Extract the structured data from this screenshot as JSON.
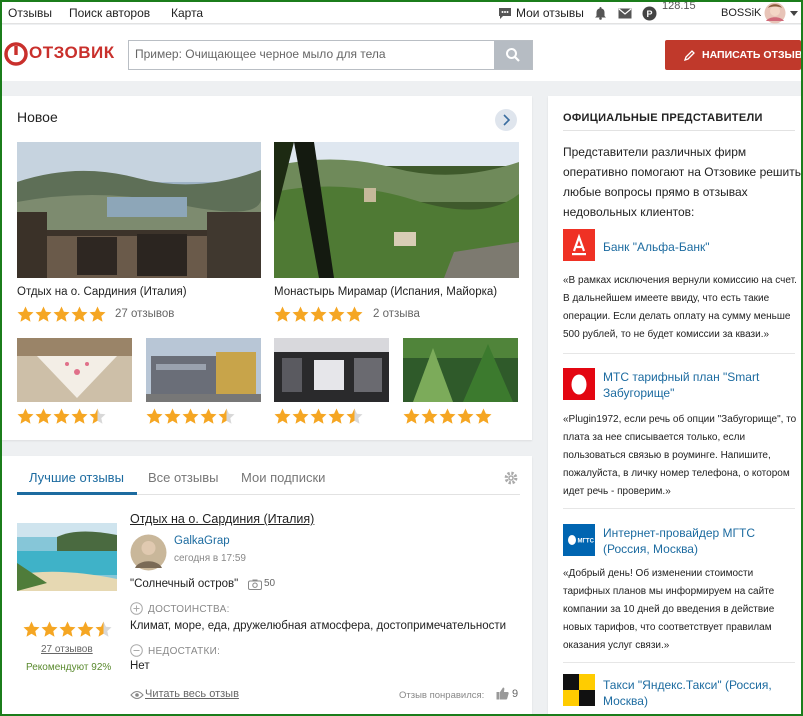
{
  "topnav": {
    "items": [
      "Отзывы",
      "Поиск авторов",
      "Карта"
    ],
    "my_reviews": "Мои отзывы",
    "rating": "128.15",
    "username": "BOSSiK"
  },
  "header": {
    "logo_text": "ОТЗОВИК",
    "search_placeholder": "Пример: Очищающее черное мыло для тела",
    "write_button": "НАПИСАТЬ ОТЗЫВ"
  },
  "new_section": {
    "title": "Новое",
    "featured": [
      {
        "title": "Отдых на о. Сардиния (Италия)",
        "rating": 5,
        "count": "27 отзывов"
      },
      {
        "title": "Монастырь Мирамар (Испания, Майорка)",
        "rating": 5,
        "count": "2 отзыва"
      }
    ],
    "small_ratings": [
      4.5,
      4.5,
      4.5,
      5
    ]
  },
  "tabs": [
    "Лучшие отзывы",
    "Все отзывы",
    "Мои подписки"
  ],
  "review": {
    "title": "Отдых на о. Сардиния (Италия)",
    "author": "GalkaGrap",
    "time": "сегодня в 17:59",
    "heading": "\"Солнечный остров\"",
    "photos": "50",
    "pros_label": "ДОСТОИНСТВА:",
    "pros": "Климат, море, еда, дружелюбная атмосфера, достопримечательности",
    "cons_label": "НЕДОСТАТКИ:",
    "cons": "Нет",
    "rating": 4.5,
    "reviews_count": "27 отзывов",
    "recommend": "Рекомендуют 92%",
    "read_full": "Читать весь отзыв",
    "liked_label": "Отзыв понравился:",
    "likes": "9"
  },
  "sidebar": {
    "title": "ОФИЦИАЛЬНЫЕ ПРЕДСТАВИТЕЛИ",
    "intro": "Представители различных фирм оперативно помогают на Отзовике решить любые вопросы прямо в отзывах недовольных клиентов:",
    "reps": [
      {
        "name": "Банк \"Альфа-Банк\"",
        "quote": "«В рамках исключения вернули комиссию на счет. В дальнейшем имеете ввиду, что есть такие операции. Если делать оплату на сумму меньше 500 рублей, то не будет комиссии за квази.»"
      },
      {
        "name": "МТС тарифный план \"Smart Забугорище\"",
        "quote": "«Plugin1972, если речь об опции \"Забугорище\", то плата за нее списывается только, если пользоваться связью в роуминге. Напишите, пожалуйста, в личку номер телефона, о котором идет речь - проверим.»"
      },
      {
        "name": "Интернет-провайдер МГТС (Россия, Москва)",
        "quote": "«Добрый день! Об изменении стоимости тарифных планов мы информируем на сайте компании за 10 дней до введения в действие новых тарифов, что соответствует правилам оказания услуг связи.»",
        "logo_text": "МГТС"
      },
      {
        "name": "Такси \"Яндекс.Такси\" (Россия, Москва)",
        "quote": ""
      }
    ]
  },
  "colors": {
    "accent": "#1c6ba0",
    "brand": "#c9302c",
    "star": "#f5a623",
    "green": "#5a8a2e"
  }
}
